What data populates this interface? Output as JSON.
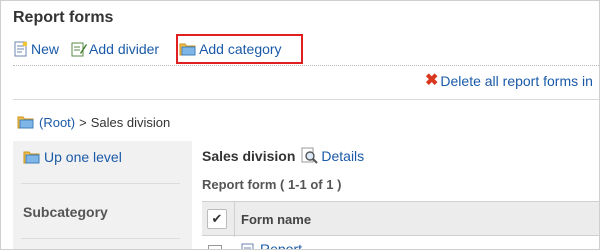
{
  "page": {
    "title": "Report forms"
  },
  "toolbar": {
    "new_label": "New",
    "add_divider_label": "Add divider",
    "add_category_label": "Add category",
    "new_icon": "new-document-icon",
    "add_divider_icon": "edit-document-icon",
    "add_category_icon": "folder-add-icon"
  },
  "actions": {
    "delete_all_label": "Delete all report forms in"
  },
  "breadcrumb": {
    "root_label": "(Root)",
    "separator": ">",
    "current": "Sales division"
  },
  "sidebar": {
    "up_one_level_label": "Up one level",
    "subcategory_heading": "Subcategory"
  },
  "content": {
    "category_name": "Sales division",
    "details_label": "Details",
    "report_count_label": "Report form ( 1-1 of 1 )"
  },
  "table": {
    "check_all_symbol": "✔",
    "column_form_name": "Form name",
    "rows": [
      {
        "name": "Report"
      }
    ]
  },
  "colors": {
    "link": "#1a5aa8",
    "highlight": "#e02020",
    "delete": "#d9381e"
  }
}
